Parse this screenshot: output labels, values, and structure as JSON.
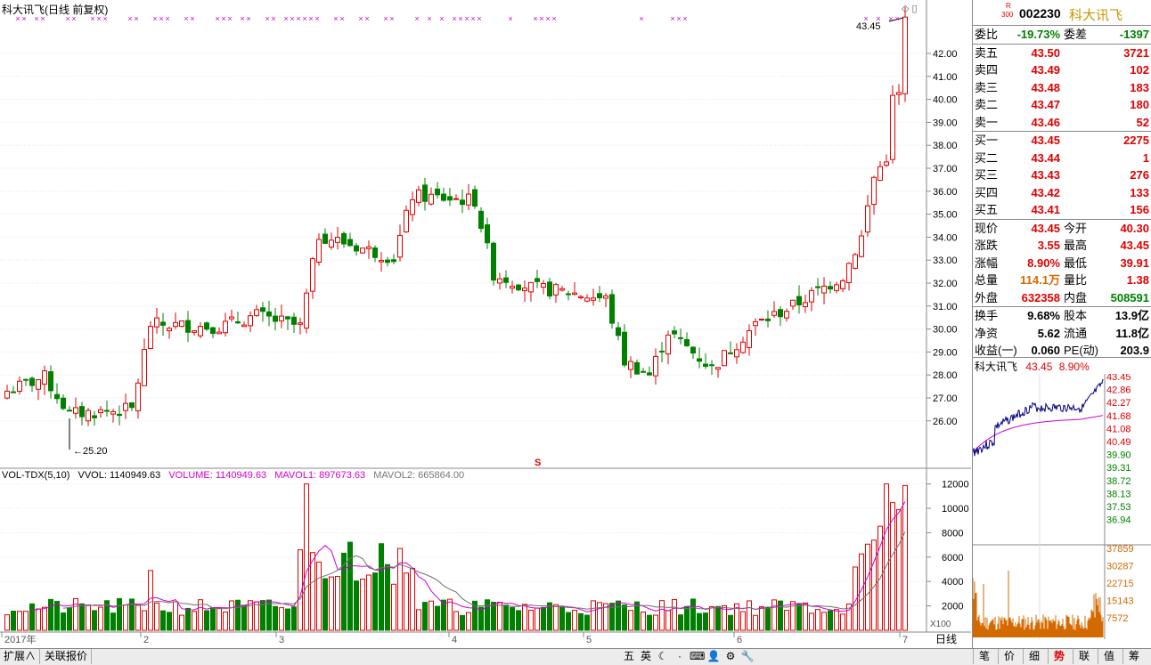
{
  "chart_title": "科大讯飞(日线 前复权)",
  "price_axis": [
    "42.00",
    "41.00",
    "40.00",
    "39.00",
    "38.00",
    "37.00",
    "36.00",
    "35.00",
    "34.00",
    "33.00",
    "32.00",
    "31.00",
    "30.00",
    "29.00",
    "28.00",
    "27.00",
    "26.00"
  ],
  "high_label": "43.45",
  "low_label": "25.20",
  "s_marker": "S",
  "vol_header": {
    "name": "VOL-TDX(5,10)",
    "vvol": "VVOL: 1140949.63",
    "volume": "VOLUME: 1140949.63",
    "mavol1": "MAVOL1: 897673.63",
    "mavol2": "MAVOL2: 665864.00"
  },
  "vol_axis": [
    "12000",
    "10000",
    "8000",
    "6000",
    "4000",
    "2000"
  ],
  "vol_unit": "X100",
  "date_axis": [
    "2017年",
    "2",
    "3",
    "4",
    "5",
    "6",
    "7"
  ],
  "period_label": "日线",
  "colors": {
    "up": "#e00000",
    "down": "#008000",
    "ma1": "#d000d0",
    "ma2": "#707070",
    "marker": "#d000d0",
    "accent": "#d26a00"
  },
  "quote": {
    "code": "002230",
    "name": "科大讯飞",
    "r_badge": "R",
    "r_sub": "300",
    "weibi_label": "委比",
    "weibi": "-19.73%",
    "weicha_label": "委差",
    "weicha": "-1397",
    "sells": [
      {
        "label": "卖五",
        "price": "43.50",
        "vol": "3721"
      },
      {
        "label": "卖四",
        "price": "43.49",
        "vol": "102"
      },
      {
        "label": "卖三",
        "price": "43.48",
        "vol": "183"
      },
      {
        "label": "卖二",
        "price": "43.47",
        "vol": "180"
      },
      {
        "label": "卖一",
        "price": "43.46",
        "vol": "52"
      }
    ],
    "buys": [
      {
        "label": "买一",
        "price": "43.45",
        "vol": "2275"
      },
      {
        "label": "买二",
        "price": "43.44",
        "vol": "1"
      },
      {
        "label": "买三",
        "price": "43.43",
        "vol": "276"
      },
      {
        "label": "买四",
        "price": "43.42",
        "vol": "133"
      },
      {
        "label": "买五",
        "price": "43.41",
        "vol": "156"
      }
    ],
    "stats": [
      {
        "l1": "现价",
        "v1": "43.45",
        "c1": "red",
        "l2": "今开",
        "v2": "40.30",
        "c2": "red"
      },
      {
        "l1": "涨跌",
        "v1": "3.55",
        "c1": "red",
        "l2": "最高",
        "v2": "43.45",
        "c2": "red"
      },
      {
        "l1": "涨幅",
        "v1": "8.90%",
        "c1": "red",
        "l2": "最低",
        "v2": "39.91",
        "c2": "red"
      },
      {
        "l1": "总量",
        "v1": "114.1万",
        "c1": "orange",
        "l2": "量比",
        "v2": "1.38",
        "c2": "red"
      },
      {
        "l1": "外盘",
        "v1": "632358",
        "c1": "red",
        "l2": "内盘",
        "v2": "508591",
        "c2": "green"
      }
    ],
    "fin": [
      {
        "l1": "换手",
        "v1": "9.68%",
        "l2": "股本",
        "v2": "13.9亿"
      },
      {
        "l1": "净资",
        "v1": "5.62",
        "l2": "流通",
        "v2": "11.8亿"
      },
      {
        "l1": "收益(一)",
        "v1": "0.060",
        "l2": "PE(动)",
        "v2": "203.9"
      }
    ]
  },
  "mini": {
    "name": "科大讯飞",
    "price": "43.45",
    "pct": "8.90%",
    "price_axis": [
      "43.45",
      "42.86",
      "42.27",
      "41.68",
      "41.08",
      "40.49",
      "39.90",
      "39.31",
      "38.72",
      "38.13",
      "37.53",
      "36.94"
    ],
    "vol_axis": [
      "37859",
      "30287",
      "22715",
      "15143",
      "7572"
    ]
  },
  "bottom": {
    "tabs": [
      "扩展∧",
      "关联报价"
    ],
    "tools": [
      "五",
      "英",
      "☾",
      "·",
      "⌨",
      "👤",
      "⚙",
      "🔧"
    ],
    "right_tabs": [
      "笔",
      "价",
      "细",
      "势",
      "联",
      "值",
      "筹"
    ]
  }
}
